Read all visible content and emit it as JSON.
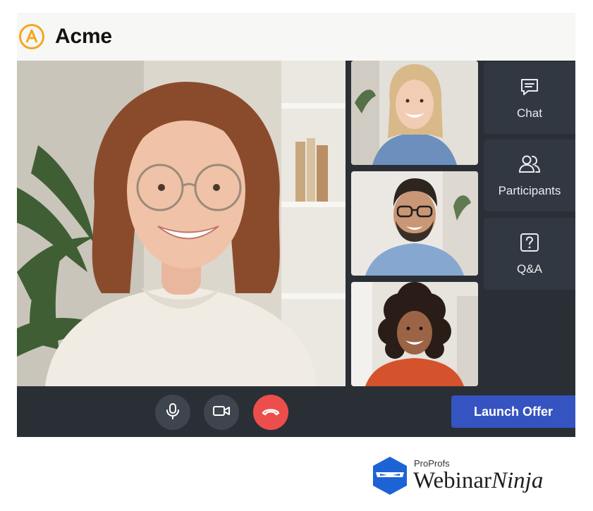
{
  "app": {
    "brand": "Acme",
    "logo_letter": "A",
    "accent": "#f5a623"
  },
  "videos": {
    "main": {
      "name": "main-speaker"
    },
    "side": [
      "participant-1",
      "participant-2",
      "participant-3"
    ]
  },
  "panel": {
    "chat_label": "Chat",
    "participants_label": "Participants",
    "qa_label": "Q&A"
  },
  "controls": {
    "mic_icon": "microphone-icon",
    "camera_icon": "camera-icon",
    "end_icon": "hang-up-icon",
    "end_color": "#ec4e4b"
  },
  "cta": {
    "label": "Launch Offer",
    "color": "#3553c1"
  },
  "footer": {
    "small": "ProProfs",
    "big_regular": "Webinar",
    "big_italic": "Ninja"
  }
}
